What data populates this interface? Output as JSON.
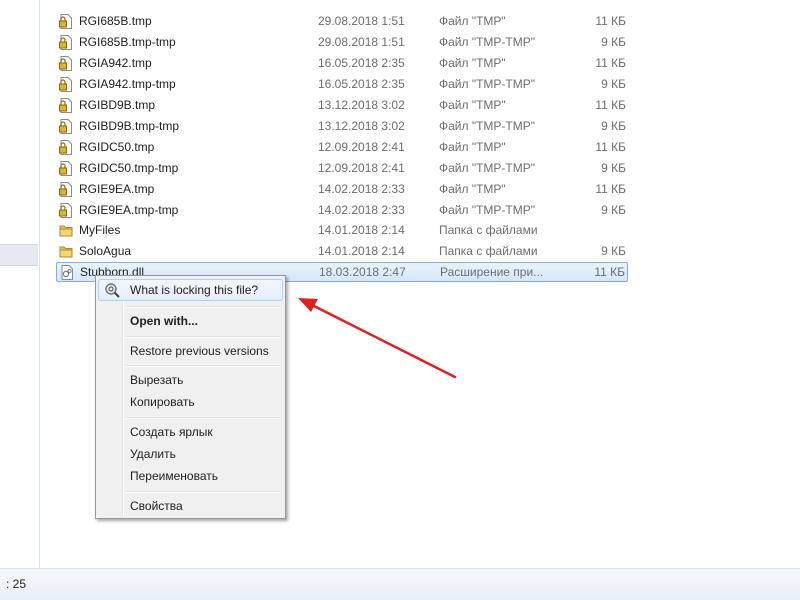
{
  "files": [
    {
      "name": "RGI685B.tmp",
      "date": "29.08.2018 1:51",
      "type": "Файл \"TMP\"",
      "size": "11 КБ",
      "icon": "locked-file-icon"
    },
    {
      "name": "RGI685B.tmp-tmp",
      "date": "29.08.2018 1:51",
      "type": "Файл \"TMP-TMP\"",
      "size": "9 КБ",
      "icon": "locked-file-icon"
    },
    {
      "name": "RGIA942.tmp",
      "date": "16.05.2018 2:35",
      "type": "Файл \"TMP\"",
      "size": "11 КБ",
      "icon": "locked-file-icon"
    },
    {
      "name": "RGIA942.tmp-tmp",
      "date": "16.05.2018 2:35",
      "type": "Файл \"TMP-TMP\"",
      "size": "9 КБ",
      "icon": "locked-file-icon"
    },
    {
      "name": "RGIBD9B.tmp",
      "date": "13.12.2018 3:02",
      "type": "Файл \"TMP\"",
      "size": "11 КБ",
      "icon": "locked-file-icon"
    },
    {
      "name": "RGIBD9B.tmp-tmp",
      "date": "13.12.2018 3:02",
      "type": "Файл \"TMP-TMP\"",
      "size": "9 КБ",
      "icon": "locked-file-icon"
    },
    {
      "name": "RGIDC50.tmp",
      "date": "12.09.2018 2:41",
      "type": "Файл \"TMP\"",
      "size": "11 КБ",
      "icon": "locked-file-icon"
    },
    {
      "name": "RGIDC50.tmp-tmp",
      "date": "12.09.2018 2:41",
      "type": "Файл \"TMP-TMP\"",
      "size": "9 КБ",
      "icon": "locked-file-icon"
    },
    {
      "name": "RGIE9EA.tmp",
      "date": "14.02.2018 2:33",
      "type": "Файл \"TMP\"",
      "size": "11 КБ",
      "icon": "locked-file-icon"
    },
    {
      "name": "RGIE9EA.tmp-tmp",
      "date": "14.02.2018 2:33",
      "type": "Файл \"TMP-TMP\"",
      "size": "9 КБ",
      "icon": "locked-file-icon"
    },
    {
      "name": "MyFiles",
      "date": "14.01.2018 2:14",
      "type": "Папка с файлами",
      "size": "",
      "icon": "folder-icon"
    },
    {
      "name": "SoloAgua",
      "date": "14.01.2018 2:14",
      "type": "Папка с файлами",
      "size": "9 КБ",
      "icon": "folder-icon"
    },
    {
      "name": "Stubborn.dll",
      "date": "18.03.2018 2:47",
      "type": "Расширение при...",
      "size": "11 КБ",
      "icon": "dll-file-icon",
      "selected": true
    }
  ],
  "context_menu": {
    "items": [
      {
        "label": "What is locking this file?",
        "icon": "magnifier-gear-icon",
        "highlighted": true
      },
      {
        "label": "Open with...",
        "bold": true
      },
      {
        "label": "Restore previous versions"
      },
      {
        "label": "Вырезать"
      },
      {
        "label": "Копировать"
      },
      {
        "label": "Создать ярлык"
      },
      {
        "label": "Удалить"
      },
      {
        "label": "Переименовать"
      },
      {
        "label": "Свойства"
      }
    ]
  },
  "status_bar": {
    "text": ": 25"
  },
  "colors": {
    "arrow": "#e02020",
    "selection_border": "#84acdd"
  }
}
